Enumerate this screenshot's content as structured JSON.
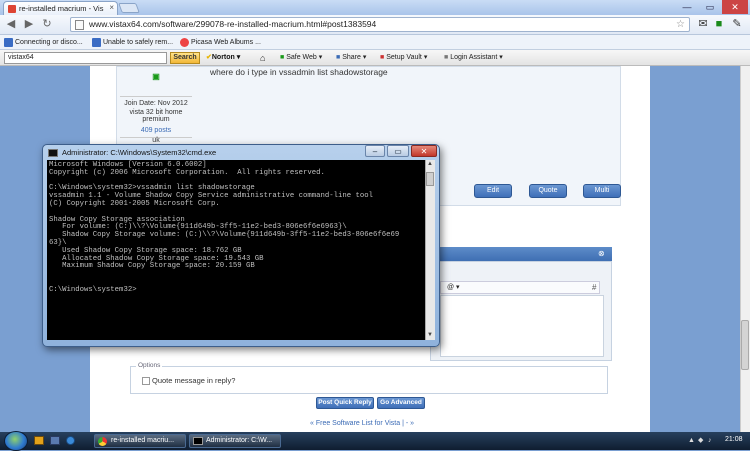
{
  "browser": {
    "tab_title": "re-installed macrium - Vis",
    "url": "www.vistax64.com/software/299078-re-installed-macrium.html#post1383594",
    "bookmarks": [
      "Connecting or disco...",
      "Unable to safely rem...",
      "Picasa Web Albums ..."
    ]
  },
  "norton": {
    "search_value": "vistax64",
    "search_button": "Search",
    "brand": "Norton",
    "items": [
      "Safe Web",
      "Share",
      "Setup Vault",
      "Login Assistant"
    ]
  },
  "post": {
    "message": "where do i type in vssadmin list shadowstorage",
    "join_date": "Join Date: Nov 2012",
    "os": "vista 32 bit home premium",
    "posts": "409 posts",
    "location": "uk",
    "buttons": [
      "Edit",
      "Quote",
      "Multi"
    ]
  },
  "cmd": {
    "title": "Administrator: C:\\Windows\\System32\\cmd.exe",
    "lines": [
      "Microsoft Windows [Version 6.0.6002]",
      "Copyright (c) 2006 Microsoft Corporation.  All rights reserved.",
      "",
      "C:\\Windows\\system32>vssadmin list shadowstorage",
      "vssadmin 1.1 - Volume Shadow Copy Service administrative command-line tool",
      "(C) Copyright 2001-2005 Microsoft Corp.",
      "",
      "Shadow Copy Storage association",
      "   For volume: (C:)\\\\?\\Volume{911d649b-3ff5-11e2-bed3-806e6f6e6963}\\",
      "   Shadow Copy Storage volume: (C:)\\\\?\\Volume{911d649b-3ff5-11e2-bed3-806e6f6e69",
      "63}\\",
      "   Used Shadow Copy Storage space: 18.762 GB",
      "   Allocated Shadow Copy Storage space: 19.543 GB",
      "   Maximum Shadow Copy Storage space: 20.159 GB",
      "",
      "",
      "C:\\Windows\\system32>"
    ]
  },
  "reply": {
    "options_legend": "Options",
    "quote_label": "Quote message in reply?",
    "post_button": "Post Quick Reply",
    "advanced_button": "Go Advanced"
  },
  "footer": {
    "link": "« Free Software List for Vista | - »"
  },
  "taskbar": {
    "items": [
      "re-installed macriu...",
      "Administrator: C:\\W..."
    ],
    "clock": "21:08"
  },
  "colors": {
    "page_bg": "#7a9fd1",
    "button_blue": "#3f6fb8",
    "cmd_bg": "#000000"
  }
}
